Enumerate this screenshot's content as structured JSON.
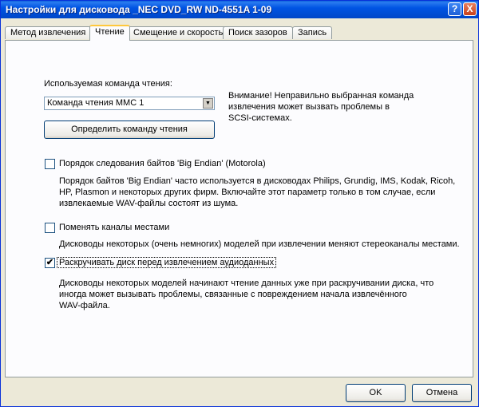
{
  "window": {
    "title": "Настройки для дисковода _NEC DVD_RW ND-4551A 1-09",
    "help_glyph": "?",
    "close_glyph": "X"
  },
  "tabs": [
    {
      "label": "Метод извлечения",
      "active": false
    },
    {
      "label": "Чтение",
      "active": true
    },
    {
      "label": "Смещение и скорость",
      "active": false
    },
    {
      "label": "Поиск зазоров",
      "active": false
    },
    {
      "label": "Запись",
      "active": false
    }
  ],
  "read_command": {
    "label": "Используемая команда чтения:",
    "value": "Команда чтения MMC 1",
    "detect_button": "Определить команду чтения",
    "warning": [
      "Внимание! Неправильно выбранная команда",
      "извлечения может вызвать проблемы в",
      "SCSI-системах."
    ]
  },
  "options": [
    {
      "label": "Порядок следования байтов 'Big Endian' (Motorola)",
      "checked": false,
      "description": [
        "Порядок байтов 'Big Endian' часто используется в дисководах Philips, Grundig, IMS, Kodak, Ricoh,",
        "HP, Plasmon и некоторых других фирм. Включайте этот параметр только в том случае, если",
        "извлекаемые WAV-файлы состоят из шума."
      ]
    },
    {
      "label": "Поменять каналы местами",
      "checked": false,
      "description": [
        "Дисководы некоторых (очень немногих) моделей при извлечении меняют стереоканалы местами."
      ]
    },
    {
      "label": "Раскручивать диск перед извлечением аудиоданных",
      "checked": true,
      "description": [
        "Дисководы некоторых моделей начинают чтение данных уже при раскручивании диска, что",
        "иногда может вызывать проблемы, связанные с повреждением начала извлечённого",
        "WAV-файла."
      ]
    }
  ],
  "footer": {
    "ok": "OK",
    "cancel": "Отмена"
  },
  "glyphs": {
    "checkmark": "✔",
    "dropdown": "▼"
  }
}
